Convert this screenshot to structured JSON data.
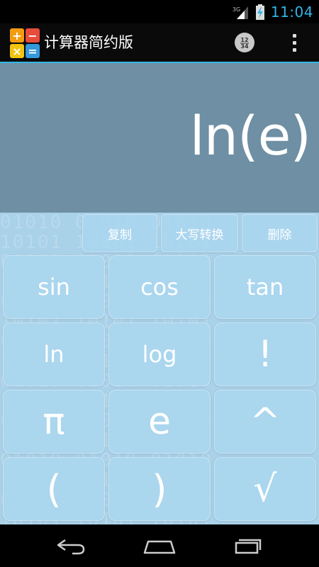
{
  "status_bar": {
    "network_type": "3G",
    "time": "11:04"
  },
  "action_bar": {
    "title": "计算器简约版",
    "app_icon_glyphs": [
      "+",
      "−",
      "×",
      "="
    ],
    "keypad_switch_glyph": "12\n34"
  },
  "display": {
    "expression": "ln(e)"
  },
  "top_row": {
    "copy": "复制",
    "case_convert": "大写转换",
    "delete": "删除"
  },
  "keys": [
    [
      "sin",
      "cos",
      "tan"
    ],
    [
      "ln",
      "log",
      "!"
    ],
    [
      "π",
      "e",
      "^"
    ],
    [
      "(",
      ")",
      "√"
    ]
  ],
  "colors": {
    "accent": "#33b5e5",
    "display_bg": "#6e8fa4",
    "keypad_bg": "#a9d1e8"
  },
  "icons": {
    "back": "back-icon",
    "home": "home-icon",
    "recents": "recents-icon",
    "overflow": "overflow-menu-icon",
    "keypad_switch": "keypad-switch-icon"
  }
}
